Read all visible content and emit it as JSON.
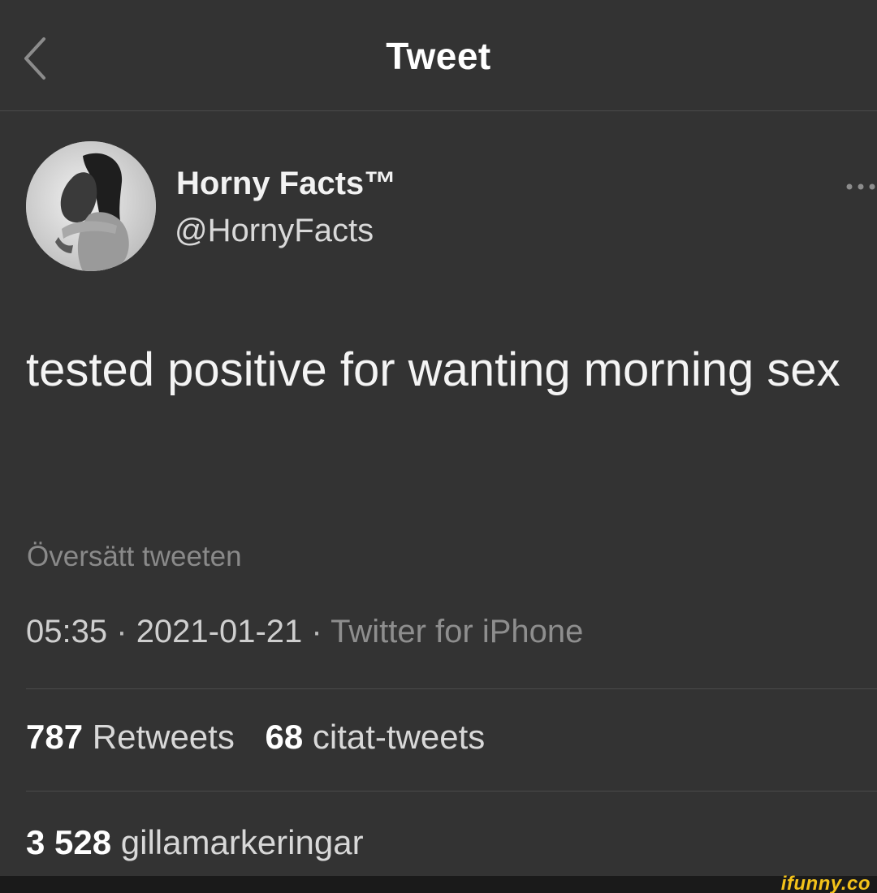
{
  "header": {
    "title": "Tweet",
    "back_icon": "chevron-left-icon"
  },
  "author": {
    "display_name": "Horny Facts™",
    "handle": "@HornyFacts",
    "more_icon": "more-horizontal-icon"
  },
  "tweet": {
    "text": "tested positive for wanting morning sex",
    "translate_label": "Översätt tweeten",
    "time": "05:35",
    "date": "2021-01-21",
    "separator": "·",
    "source": "Twitter for iPhone"
  },
  "stats": {
    "retweets_count": "787",
    "retweets_label": "Retweets",
    "quotes_count": "68",
    "quotes_label": "citat-tweets",
    "likes_count": "3 528",
    "likes_label": "gillamarkeringar"
  },
  "watermark": {
    "text": "ifunny.co"
  },
  "colors": {
    "background": "#333333",
    "divider": "#4a4a4a",
    "muted_text": "#8a8a8a",
    "watermark": "#f3c21a"
  }
}
